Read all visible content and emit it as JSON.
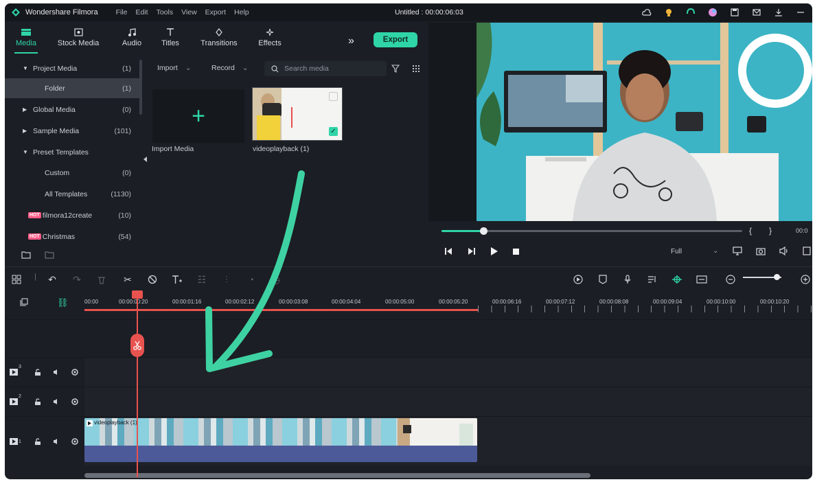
{
  "app": {
    "name": "Wondershare Filmora",
    "document_title": "Untitled : 00:00:06:03",
    "menus": [
      "File",
      "Edit",
      "Tools",
      "View",
      "Export",
      "Help"
    ]
  },
  "tabs": [
    {
      "label": "Media",
      "icon": "folder-icon",
      "active": true
    },
    {
      "label": "Stock Media",
      "icon": "stock-media-icon",
      "active": false
    },
    {
      "label": "Audio",
      "icon": "music-note-icon",
      "active": false
    },
    {
      "label": "Titles",
      "icon": "text-t-icon",
      "active": false
    },
    {
      "label": "Transitions",
      "icon": "transition-icon",
      "active": false
    },
    {
      "label": "Effects",
      "icon": "effects-icon",
      "active": false
    }
  ],
  "export_label": "Export",
  "sidebar": {
    "items": [
      {
        "label": "Project Media",
        "count": "(1)",
        "arrow": "▼"
      },
      {
        "label": "Folder",
        "count": "(1)",
        "arrow": ""
      },
      {
        "label": "Global Media",
        "count": "(0)",
        "arrow": "▶"
      },
      {
        "label": "Sample Media",
        "count": "(101)",
        "arrow": "▶"
      },
      {
        "label": "Preset Templates",
        "count": "",
        "arrow": "▼"
      },
      {
        "label": "Custom",
        "count": "(0)",
        "arrow": ""
      },
      {
        "label": "All Templates",
        "count": "(1130)",
        "arrow": ""
      },
      {
        "label": "filmora12create",
        "count": "(10)",
        "arrow": "",
        "badge": "HOT"
      },
      {
        "label": "Christmas",
        "count": "(54)",
        "arrow": "",
        "badge": "HOT"
      }
    ]
  },
  "media_toolbar": {
    "import_label": "Import",
    "record_label": "Record",
    "search_placeholder": "Search media"
  },
  "media_items": {
    "import_label": "Import Media",
    "video_label": "videoplayback (1)"
  },
  "preview": {
    "quality_label": "Full",
    "timecode_partial": "00:0"
  },
  "ruler": {
    "labels": [
      "00:00",
      "00:00:00:20",
      "00:00:01:16",
      "00:00:02:12",
      "00:00:03:08",
      "00:00:04:04",
      "00:00:05:00",
      "00:00:05:20",
      "00:00:06:16",
      "00:00:07:12",
      "00:00:08:08",
      "00:00:09:04",
      "00:00:10:00",
      "00:00:10:20"
    ]
  },
  "tracks": [
    {
      "number": "3"
    },
    {
      "number": "2"
    },
    {
      "number": "1"
    }
  ],
  "clip_label": "videoplayback (1)",
  "colors": {
    "accent": "#2fd4a7",
    "playhead": "#e8534f",
    "panel": "#1b1e24",
    "clip": "#4d5a9a"
  }
}
